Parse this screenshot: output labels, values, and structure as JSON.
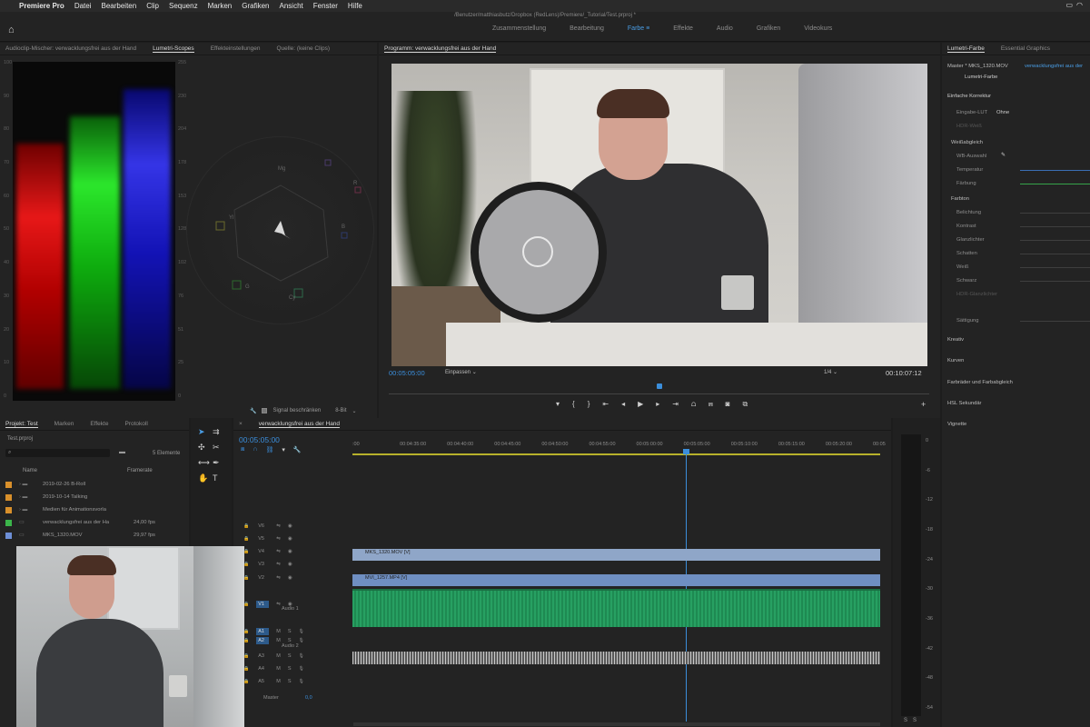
{
  "menubar": {
    "apple": "",
    "app": "Premiere Pro",
    "items": [
      "Datei",
      "Bearbeiten",
      "Clip",
      "Sequenz",
      "Marken",
      "Grafiken",
      "Ansicht",
      "Fenster",
      "Hilfe"
    ]
  },
  "path": "/Benutzer/matthiasbutz/Dropbox (RedLens)/Premiere/_Tutorial/Test.prproj *",
  "workspaces": [
    "Zusammenstellung",
    "Bearbeitung",
    "Farbe",
    "Effekte",
    "Audio",
    "Grafiken",
    "Videokurs"
  ],
  "scopes": {
    "tabs": [
      "Audioclip-Mischer: verwacklungsfrei aus der Hand",
      "Lumetri-Scopes",
      "Effekteinstellungen",
      "Quelle: (keine Clips)"
    ],
    "left_scale": [
      "100",
      "90",
      "80",
      "70",
      "60",
      "50",
      "40",
      "30",
      "20",
      "10",
      "0"
    ],
    "right_scale": [
      "255",
      "230",
      "204",
      "178",
      "153",
      "128",
      "102",
      "76",
      "51",
      "25",
      "0"
    ],
    "vector_labels": [
      "R",
      "Mg",
      "B",
      "Cy",
      "G",
      "Yl"
    ],
    "signal_label": "Signal beschränken",
    "bits": "8-Bit"
  },
  "program": {
    "title": "Programm: verwacklungsfrei aus der Hand",
    "timecode_left": "00:05:05:00",
    "fit": "Einpassen",
    "scale": "1/4",
    "timecode_right": "00:10:07:12"
  },
  "lumetri": {
    "tabs": [
      "Lumetri-Farbe",
      "Essential Graphics"
    ],
    "master": "Master * MKS_1320.MOV",
    "seq": "verwacklungsfrei aus der",
    "fx": "Lumetri-Farbe",
    "basic": "Einfache Korrektur",
    "lut_label": "Eingabe-LUT",
    "lut_value": "Ohne",
    "hdr": "HDR-Weiß",
    "wb": "Weißabgleich",
    "wb_pick": "WB-Auswahl",
    "temp": "Temperatur",
    "tint": "Färbung",
    "tone": "Farbton",
    "tone_items": [
      "Belichtung",
      "Kontrast",
      "Glanzlichter",
      "Schatten",
      "Weiß",
      "Schwarz",
      "HDR-Glanzlichter"
    ],
    "sat": "Sättigung",
    "sections": [
      "Kreativ",
      "Kurven",
      "Farbräder und Farbabgleich",
      "HSL Sekundär",
      "Vignette"
    ]
  },
  "project": {
    "tabs": [
      "Projekt: Test",
      "Marken",
      "Effekte",
      "Protokoll"
    ],
    "file": "Test.prproj",
    "count": "5 Elemente",
    "col_name": "Name",
    "col_fps": "Framerate",
    "items": [
      {
        "name": "2019-02-26 B-Roll",
        "fps": "",
        "color": "#d9902b"
      },
      {
        "name": "2019-10-14 Talking",
        "fps": "",
        "color": "#d9902b"
      },
      {
        "name": "Medien für Animationsvorla",
        "fps": "",
        "color": "#d9902b"
      },
      {
        "name": "verwacklungsfrei aus der Ha",
        "fps": "24,00 fps",
        "color": "#3bb54a"
      },
      {
        "name": "MKS_1320.MOV",
        "fps": "29,97 fps",
        "color": "#6d8fd6"
      }
    ]
  },
  "timeline": {
    "title": "verwacklungsfrei aus der Hand",
    "timecode": "00:05:05:00",
    "ruler": [
      ":00",
      "00:04:35:00",
      "00:04:40:00",
      "00:04:45:00",
      "00:04:50:00",
      "00:04:55:00",
      "00:05:00:00",
      "00:05:05:00",
      "00:05:10:00",
      "00:05:15:00",
      "00:05:20:00",
      "00:05"
    ],
    "tracks": [
      "V6",
      "V5",
      "V4",
      "V3",
      "V2",
      "V1",
      "A1",
      "A2",
      "A3",
      "A4",
      "A5"
    ],
    "clip_v3": "MKS_1320.MOV [V]",
    "clip_v1": "MVI_1257.MP4 [V]",
    "a1_name": "Audio 1",
    "a2_name": "Audio 2",
    "master": "Master",
    "master_val": "0,0"
  },
  "meter": {
    "scale": [
      "0",
      "-6",
      "-12",
      "-18",
      "-24",
      "-30",
      "-36",
      "-42",
      "-48",
      "-54"
    ],
    "bottom": [
      "S",
      "S"
    ]
  }
}
